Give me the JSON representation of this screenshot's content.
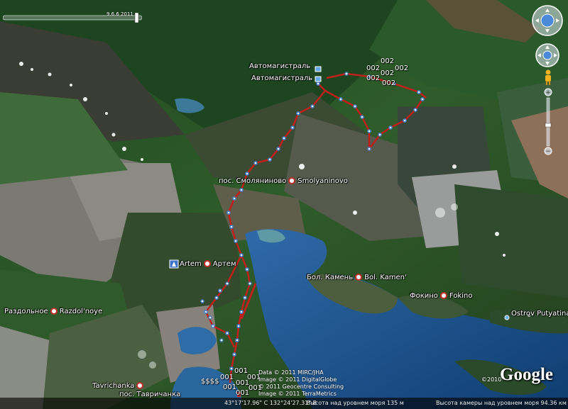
{
  "places": {
    "highway_1": "Автомагистраль",
    "highway_2": "Автомагистраль",
    "smolyaninovo_ru": "пос. Смоляниново",
    "smolyaninovo_en": "Smolyaninovo",
    "artem_en": "Artem",
    "artem_ru": "Артем",
    "razdolnoye_ru": "Раздольное",
    "razdolnoye_en": "Razdol'noye",
    "bol_kamen_ru": "Бол. Камень",
    "bol_kamen_en": "Bol. Kamen'",
    "fokino_ru": "Фокино",
    "fokino_en": "Fokino",
    "putyatina": "Ostrov Putyatina",
    "tavrichanka_en": "Tavrichanka",
    "tavrichanka_ru": "пос. Тавричанка"
  },
  "waypoints": {
    "north": [
      "002",
      "002",
      "002",
      "002",
      "002",
      "002"
    ],
    "south": [
      "001",
      "001",
      "001",
      "001",
      "001",
      "001",
      "001"
    ],
    "dollar": "$$$$"
  },
  "credits": {
    "line1": "Data © 2011 MIRC/JHA",
    "line2": "Image © 2011 DigitalGlobe",
    "line3": "© 2011 Geocentre Consulting",
    "line4": "Image © 2011 TerraMetrics"
  },
  "logo": {
    "year": "©2010",
    "text": "Google"
  },
  "timeline": {
    "date": "9.6.6 2011"
  },
  "status": {
    "coords": "43°17'17.96\" С 132°24'27.31\" В",
    "elevation": "Высота над уровнем моря  135 м",
    "eye_alt": "Высота камеры над уровнем моря    94.36 км"
  },
  "colors": {
    "track": "#c0201c",
    "waypoint": "#4a7fc8",
    "water": "#1e5d96"
  }
}
